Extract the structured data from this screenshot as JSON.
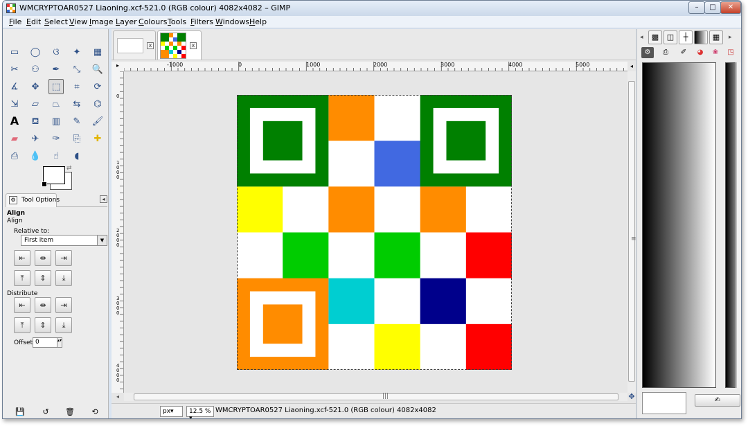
{
  "window": {
    "title": "WMCRYPTOAR0527 Liaoning.xcf-521.0 (RGB colour) 4082x4082 – GIMP",
    "minimize_glyph": "–",
    "maximize_glyph": "□",
    "close_glyph": "✕"
  },
  "menubar": {
    "items": [
      "File",
      "Edit",
      "Select",
      "View",
      "Image",
      "Layer",
      "Colours",
      "Tools",
      "Filters",
      "Windows",
      "Help"
    ]
  },
  "toolbox": {
    "tools": [
      {
        "name": "rect-select-icon",
        "glyph": "▭"
      },
      {
        "name": "ellipse-select-icon",
        "glyph": "◯"
      },
      {
        "name": "free-select-icon",
        "glyph": "ଓ"
      },
      {
        "name": "fuzzy-select-icon",
        "glyph": "✦"
      },
      {
        "name": "select-by-color-icon",
        "glyph": "▦"
      },
      {
        "name": "scissors-icon",
        "glyph": "✂"
      },
      {
        "name": "foreground-select-icon",
        "glyph": "⚇"
      },
      {
        "name": "paths-icon",
        "glyph": "✒"
      },
      {
        "name": "color-picker-icon",
        "glyph": "⤡"
      },
      {
        "name": "zoom-icon",
        "glyph": "🔍"
      },
      {
        "name": "measure-icon",
        "glyph": "∡"
      },
      {
        "name": "move-icon",
        "glyph": "✥"
      },
      {
        "name": "align-icon",
        "glyph": "⬚"
      },
      {
        "name": "crop-icon",
        "glyph": "⌗"
      },
      {
        "name": "rotate-icon",
        "glyph": "⟳"
      },
      {
        "name": "scale-icon",
        "glyph": "⇲"
      },
      {
        "name": "shear-icon",
        "glyph": "▱"
      },
      {
        "name": "perspective-icon",
        "glyph": "⏢"
      },
      {
        "name": "flip-icon",
        "glyph": "⇆"
      },
      {
        "name": "cage-transform-icon",
        "glyph": "⌬"
      },
      {
        "name": "text-icon",
        "glyph": "A"
      },
      {
        "name": "bucket-fill-icon",
        "glyph": "⛾"
      },
      {
        "name": "blend-icon",
        "glyph": "▥"
      },
      {
        "name": "pencil-icon",
        "glyph": "✎"
      },
      {
        "name": "paintbrush-icon",
        "glyph": "🖌"
      },
      {
        "name": "eraser-icon",
        "glyph": "▰"
      },
      {
        "name": "airbrush-icon",
        "glyph": "✈"
      },
      {
        "name": "ink-icon",
        "glyph": "✑"
      },
      {
        "name": "clone-icon",
        "glyph": "⎘"
      },
      {
        "name": "heal-icon",
        "glyph": "✚"
      },
      {
        "name": "perspective-clone-icon",
        "glyph": "⎙"
      },
      {
        "name": "blur-icon",
        "glyph": "💧"
      },
      {
        "name": "smudge-icon",
        "glyph": "☝"
      },
      {
        "name": "dodge-burn-icon",
        "glyph": "◖"
      }
    ],
    "tool_options_tab": "Tool Options",
    "tool_options_icon_glyph": "⚙",
    "panel_menu_glyph": "◂",
    "align_heading": "Align",
    "align_subheading": "Align",
    "relative_label": "Relative to:",
    "relative_value": "First item",
    "dropdown_glyph": "▼",
    "align_buttons": [
      "⇤",
      "⇹",
      "⇥",
      "⤒",
      "⇕",
      "⤓"
    ],
    "distribute_label": "Distribute",
    "distribute_buttons": [
      "⇤",
      "⇹",
      "⇥",
      "⤒",
      "⇕",
      "⤓"
    ],
    "offset_label": "Offset:",
    "offset_value": "0",
    "spin_glyph": "▴▾",
    "swap_colors_glyph": "⇄",
    "bottom_buttons": [
      "💾",
      "↺",
      "🗑",
      "⟲"
    ]
  },
  "image_window": {
    "tab_close_glyph": "x",
    "ruler_corner_glyph": "▸",
    "nav_quick_glyph": "◂",
    "hruler_labels": [
      "-1000",
      "0",
      "1000",
      "2000",
      "3000",
      "4000",
      "5000"
    ],
    "vruler_labels": [
      "0",
      "1000",
      "2000",
      "3000",
      "4000"
    ],
    "vscroll_grip": "≡",
    "hscroll_grip": "|||",
    "navigate_glyph": "✥",
    "zoom_corner_glyph": "◂",
    "unit": "px▾",
    "zoom": "12.5 % ▾",
    "status": "WMCRYPTOAR0527 Liaoning.xcf-521.0 (RGB colour) 4082x4082"
  },
  "artwork": {
    "grid_size": 6,
    "cells": [
      [
        "finder-green",
        "finder-green",
        "#ff8c00",
        "#ffffff",
        "finder-green",
        "finder-green"
      ],
      [
        "finder-green",
        "finder-green",
        "#ffffff",
        "#4169e1",
        "finder-green",
        "finder-green"
      ],
      [
        "#ffff00",
        "#ffffff",
        "#ff8c00",
        "#ffffff",
        "#ff8c00",
        "#ffffff"
      ],
      [
        "#ffffff",
        "#00cc00",
        "#ffffff",
        "#00cc00",
        "#ffffff",
        "#ff0000"
      ],
      [
        "finder-orange",
        "finder-orange",
        "#00ced1",
        "#ffffff",
        "#00008b",
        "#ffffff"
      ],
      [
        "finder-orange",
        "finder-orange",
        "#ffffff",
        "#ffff00",
        "#ffffff",
        "#ff0000"
      ]
    ],
    "finders": [
      {
        "row": 0,
        "col": 0,
        "color": "#008000"
      },
      {
        "row": 0,
        "col": 4,
        "color": "#008000"
      },
      {
        "row": 4,
        "col": 0,
        "color": "#ff8c00"
      }
    ]
  },
  "dock": {
    "top_tabs": [
      {
        "name": "pattern-tab-icon",
        "glyph": "▩"
      },
      {
        "name": "brush-tab-icon",
        "glyph": "◫"
      },
      {
        "name": "paint-dynamics-tab-icon",
        "glyph": "┼"
      },
      {
        "name": "gradient-tab-icon",
        "glyph": "▮"
      },
      {
        "name": "palette-tab-icon",
        "glyph": "▦"
      }
    ],
    "left_arrow": "◂",
    "right_arrow": "▸",
    "second_row": [
      {
        "name": "tool-presets-icon",
        "glyph": "⚙"
      },
      {
        "name": "printer-icon",
        "glyph": "⎙"
      },
      {
        "name": "brush-icon",
        "glyph": "✐"
      },
      {
        "name": "color-wheel-icon",
        "glyph": "◕"
      },
      {
        "name": "fonts-icon",
        "glyph": "❀"
      },
      {
        "name": "palette-small-icon",
        "glyph": "◳"
      }
    ],
    "panel_menu_glyph": "◂",
    "edit_button_glyph": "✍"
  },
  "colors": {
    "finder_green": "#008000",
    "finder_orange": "#ff8c00"
  }
}
